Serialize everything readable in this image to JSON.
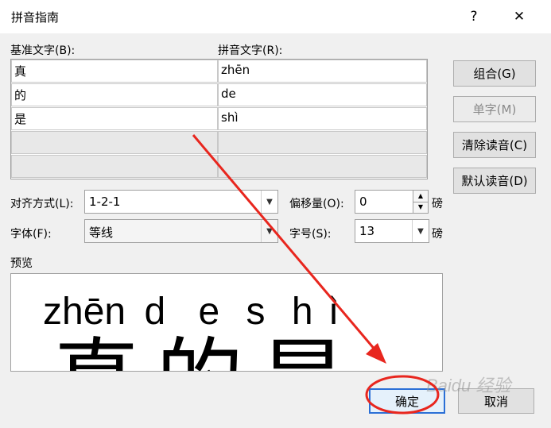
{
  "dialog": {
    "title": "拼音指南",
    "help": "?",
    "close": "✕"
  },
  "base_text": {
    "label": "基准文字(B):",
    "rows": [
      "真",
      "的",
      "是",
      "",
      ""
    ]
  },
  "pinyin_text": {
    "label": "拼音文字(R):",
    "rows": [
      "zhēn",
      "de",
      "shì",
      "",
      ""
    ]
  },
  "buttons": {
    "combine": "组合(G)",
    "single": "单字(M)",
    "clear": "清除读音(C)",
    "default": "默认读音(D)",
    "ok": "确定",
    "cancel": "取消"
  },
  "options": {
    "align_label": "对齐方式(L):",
    "align_value": "1-2-1",
    "offset_label": "偏移量(O):",
    "offset_value": "0",
    "offset_unit": "磅",
    "font_label": "字体(F):",
    "font_value": "等线",
    "size_label": "字号(S):",
    "size_value": "13",
    "size_unit": "磅"
  },
  "preview": {
    "label": "预览",
    "pinyin": [
      "zhēn",
      "d",
      "e",
      "s",
      "h",
      "ì"
    ],
    "hanzi": "真的是"
  },
  "watermark": "Baidu 经验",
  "colors": {
    "annotation_red": "#e8261e",
    "ok_border": "#2b6fd6"
  }
}
